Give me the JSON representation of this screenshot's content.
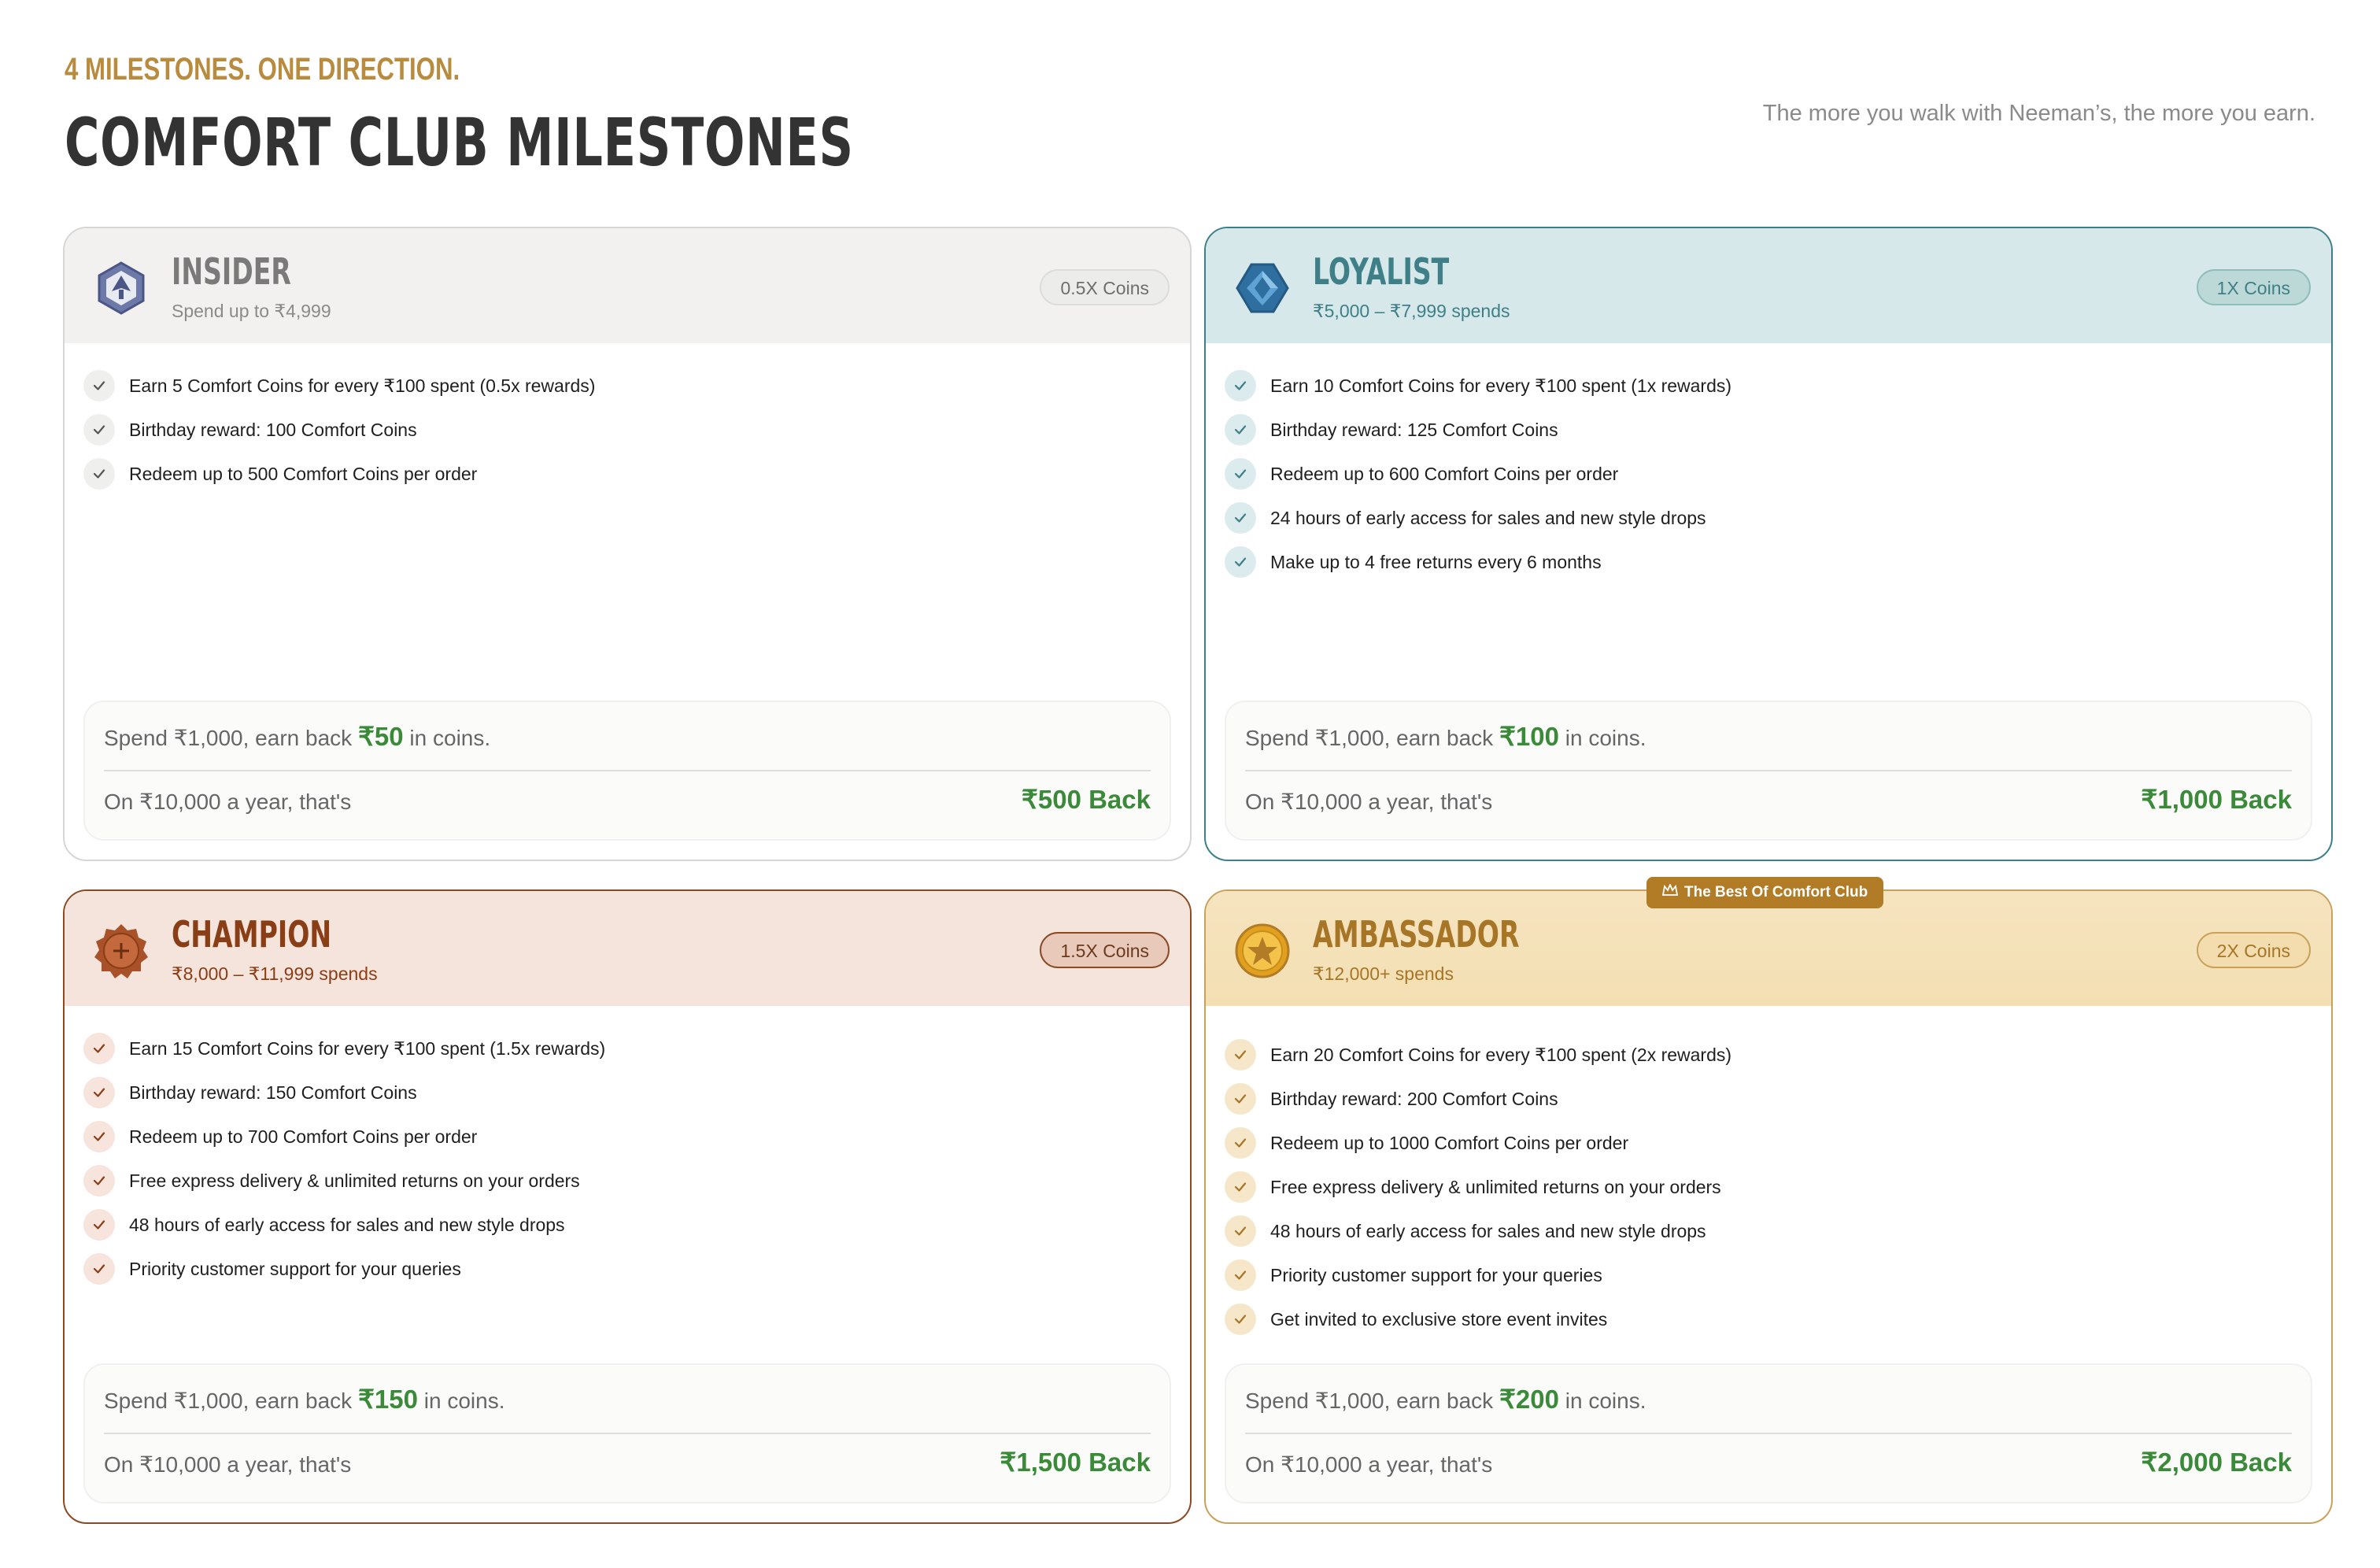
{
  "header": {
    "eyebrow": "4 MILESTONES. ONE DIRECTION.",
    "title": "COMFORT CLUB MILESTONES",
    "tagline": "The more you walk with Neeman’s, the more you earn."
  },
  "colors": {
    "insider": "#7a7a7a",
    "loyalist": "#3f7f88",
    "champion": "#8a3e16",
    "ambassador": "#a67526",
    "reward_green": "#3a8a3a"
  },
  "tiers": {
    "insider": {
      "icon": "hexagon-badge-icon",
      "name": "INSIDER",
      "range": "Spend up to ₹4,999",
      "coins": "0.5X Coins",
      "benefits": [
        "Earn 5 Comfort Coins for every ₹100 spent (0.5x rewards)",
        "Birthday reward: 100 Comfort Coins",
        "Redeem up to 500 Comfort Coins per order"
      ],
      "calc": {
        "pre": "Spend ₹1,000, earn back ",
        "amount": "₹50",
        "post": " in coins.",
        "year_label": "On ₹10,000 a year, that's",
        "back": "₹500 Back"
      }
    },
    "loyalist": {
      "icon": "diamond-badge-icon",
      "name": "LOYALIST",
      "range": "₹5,000 – ₹7,999 spends",
      "coins": "1X Coins",
      "benefits": [
        "Earn 10 Comfort Coins for every ₹100 spent (1x rewards)",
        "Birthday reward: 125 Comfort Coins",
        "Redeem up to 600 Comfort Coins per order",
        "24 hours of early access for sales and new style drops",
        "Make up to 4 free returns every 6 months"
      ],
      "calc": {
        "pre": "Spend ₹1,000, earn back ",
        "amount": "₹100",
        "post": " in coins.",
        "year_label": "On ₹10,000 a year, that's",
        "back": "₹1,000 Back"
      }
    },
    "champion": {
      "icon": "bronze-seal-icon",
      "name": "CHAMPION",
      "range": "₹8,000 – ₹11,999 spends",
      "coins": "1.5X Coins",
      "benefits": [
        "Earn 15 Comfort Coins for every ₹100 spent (1.5x rewards)",
        "Birthday reward: 150 Comfort Coins",
        "Redeem up to 700 Comfort Coins per order",
        "Free express delivery & unlimited returns on your orders",
        "48 hours of early access for sales and new style drops",
        "Priority customer support for your queries"
      ],
      "calc": {
        "pre": "Spend ₹1,000, earn back ",
        "amount": "₹150",
        "post": " in coins.",
        "year_label": "On ₹10,000 a year, that's",
        "back": "₹1,500 Back"
      }
    },
    "ambassador": {
      "icon": "gold-star-coin-icon",
      "name": "AMBASSADOR",
      "range": "₹12,000+ spends",
      "coins": "2X Coins",
      "ribbon": "The Best Of Comfort Club",
      "benefits": [
        "Earn 20 Comfort Coins for every ₹100 spent (2x rewards)",
        "Birthday reward: 200 Comfort Coins",
        "Redeem up to 1000 Comfort Coins per order",
        "Free express delivery & unlimited returns on your orders",
        "48 hours of early access for sales and new style drops",
        "Priority customer support for your queries",
        "Get invited to exclusive store event invites"
      ],
      "calc": {
        "pre": "Spend ₹1,000, earn back ",
        "amount": "₹200",
        "post": " in coins.",
        "year_label": "On ₹10,000 a year, that's",
        "back": "₹2,000 Back"
      }
    }
  }
}
